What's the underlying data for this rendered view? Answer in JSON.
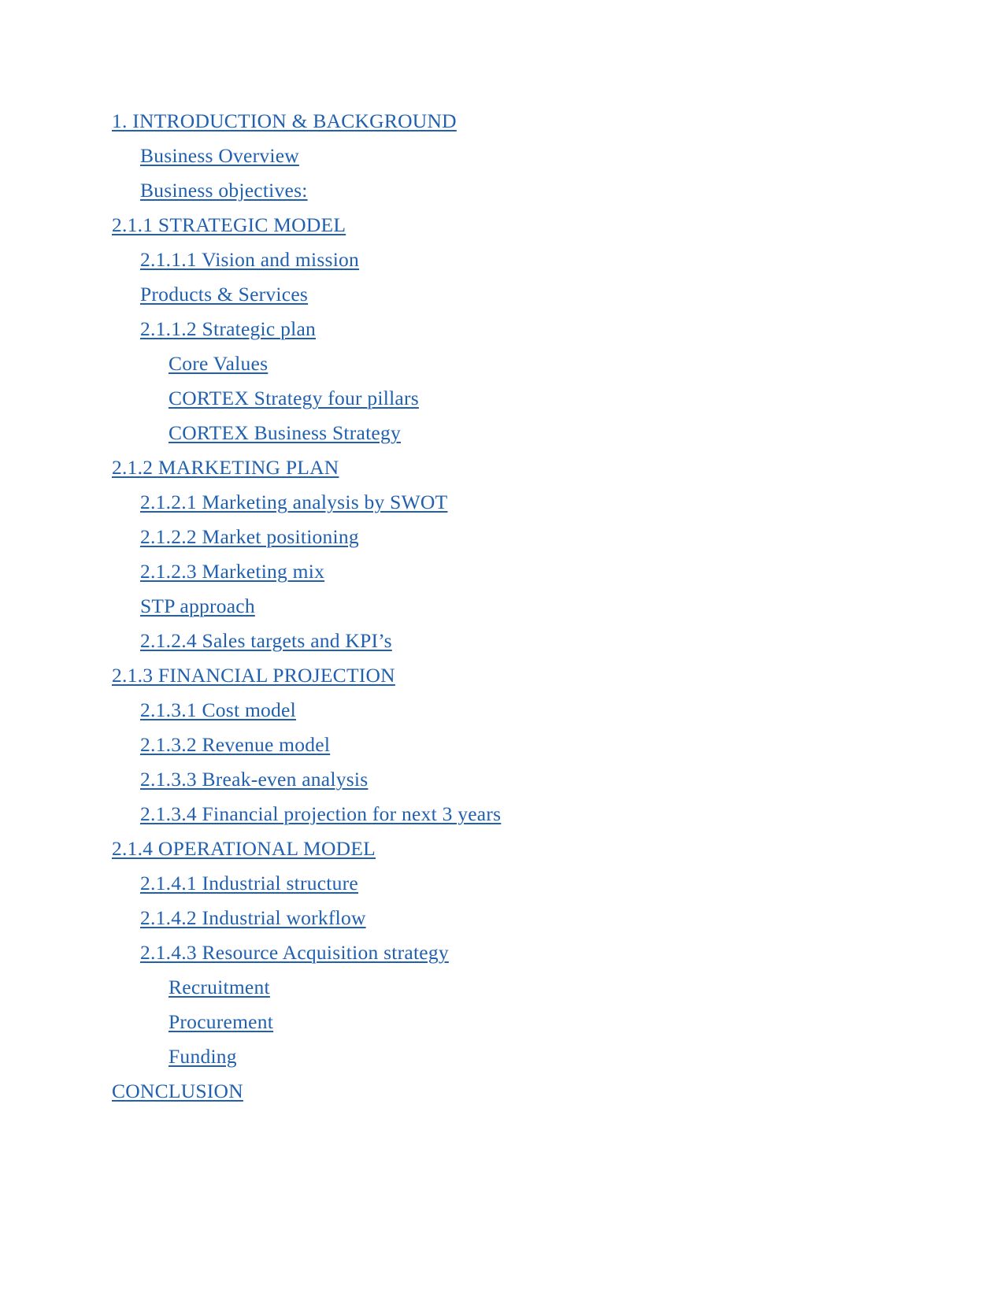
{
  "document": {
    "type": "table-of-contents",
    "link_color": "#2060AE",
    "background_color": "#FFFFFF",
    "entries": [
      {
        "label": "1. INTRODUCTION & BACKGROUND",
        "level": 1
      },
      {
        "label": "Business Overview",
        "level": 2
      },
      {
        "label": "Business objectives:",
        "level": 2
      },
      {
        "label": "2.1.1 STRATEGIC MODEL",
        "level": 1
      },
      {
        "label": "2.1.1.1 Vision and mission",
        "level": 2
      },
      {
        "label": "Products & Services",
        "level": 2
      },
      {
        "label": "2.1.1.2 Strategic plan",
        "level": 2
      },
      {
        "label": "Core Values",
        "level": 3
      },
      {
        "label": "CORTEX Strategy four pillars",
        "level": 3
      },
      {
        "label": "CORTEX Business Strategy",
        "level": 3
      },
      {
        "label": "2.1.2 MARKETING PLAN",
        "level": 1
      },
      {
        "label": "2.1.2.1 Marketing analysis by SWOT",
        "level": 2
      },
      {
        "label": "2.1.2.2 Market positioning",
        "level": 2
      },
      {
        "label": "2.1.2.3 Marketing mix",
        "level": 2
      },
      {
        "label": "STP approach",
        "level": 2
      },
      {
        "label": "2.1.2.4 Sales targets and KPI’s",
        "level": 2
      },
      {
        "label": "2.1.3 FINANCIAL PROJECTION",
        "level": 1
      },
      {
        "label": "2.1.3.1 Cost model",
        "level": 2
      },
      {
        "label": "2.1.3.2 Revenue model",
        "level": 2
      },
      {
        "label": "2.1.3.3 Break-even analysis",
        "level": 2
      },
      {
        "label": "2.1.3.4 Financial projection for next 3 years",
        "level": 2
      },
      {
        "label": "2.1.4 OPERATIONAL MODEL",
        "level": 1
      },
      {
        "label": "2.1.4.1 Industrial structure",
        "level": 2
      },
      {
        "label": "2.1.4.2 Industrial workflow",
        "level": 2
      },
      {
        "label": "2.1.4.3 Resource Acquisition strategy",
        "level": 2
      },
      {
        "label": "Recruitment",
        "level": 3
      },
      {
        "label": "Procurement",
        "level": 3
      },
      {
        "label": "Funding",
        "level": 3
      },
      {
        "label": "CONCLUSION",
        "level": 1
      }
    ]
  }
}
